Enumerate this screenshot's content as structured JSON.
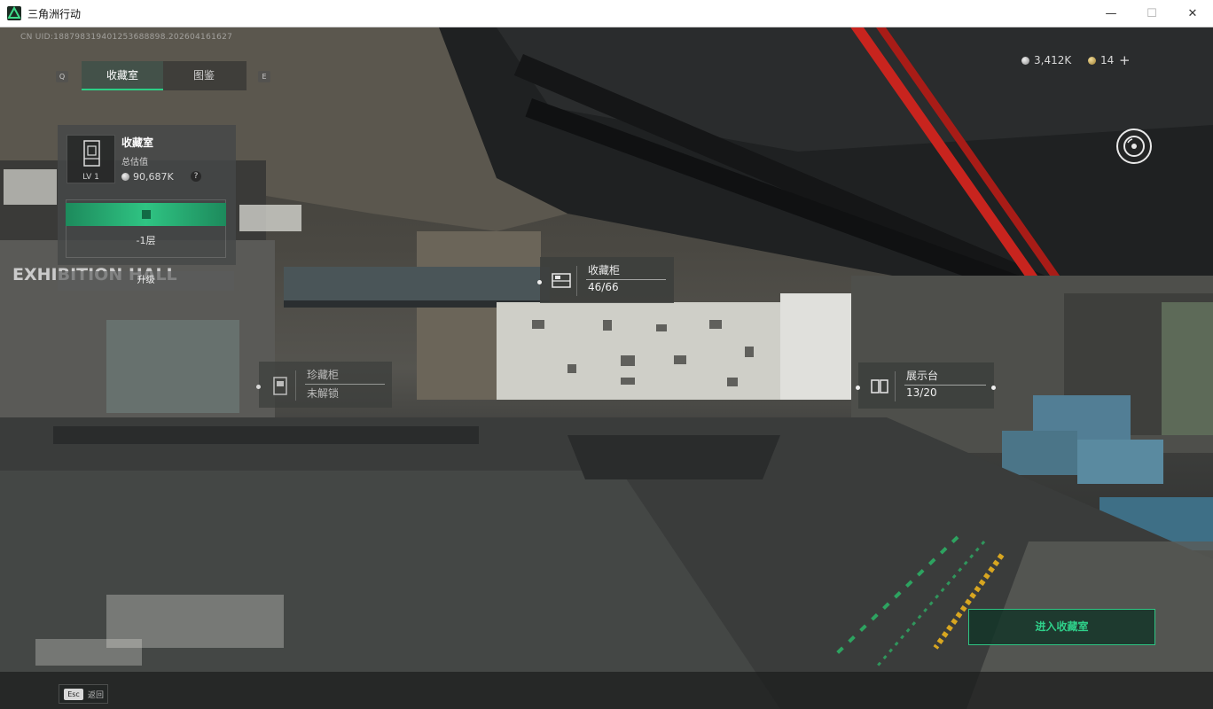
{
  "window": {
    "title": "三角洲行动",
    "minimize": "—",
    "maximize": "☐",
    "close": "✕"
  },
  "hud": {
    "uid": "CN UID:188798319401253688898.202604161627",
    "tab_left_key": "Q",
    "tab_right_key": "E",
    "tabs": [
      {
        "label": "收藏室",
        "active": true
      },
      {
        "label": "图鉴",
        "active": false
      }
    ],
    "currency_silver": "3,412K",
    "currency_gold": "14",
    "plus": "+"
  },
  "panel": {
    "title": "收藏室",
    "level": "LV 1",
    "value_label": "总估值",
    "value": "90,687K",
    "help": "?",
    "floor": "-1层",
    "upgrade": "升级"
  },
  "scene": {
    "wall_text": "EXHIBITION HALL"
  },
  "hotspots": [
    {
      "name": "收藏柜",
      "value": "46/66"
    },
    {
      "name": "珍藏柜",
      "value": "未解锁"
    },
    {
      "name": "展示台",
      "value": "13/20"
    }
  ],
  "enter_button": "进入收藏室",
  "footer": {
    "esc_key": "Esc",
    "esc_text": "返回"
  },
  "colors": {
    "accent_green": "#2fc483",
    "pipe_red": "#c8241e"
  }
}
